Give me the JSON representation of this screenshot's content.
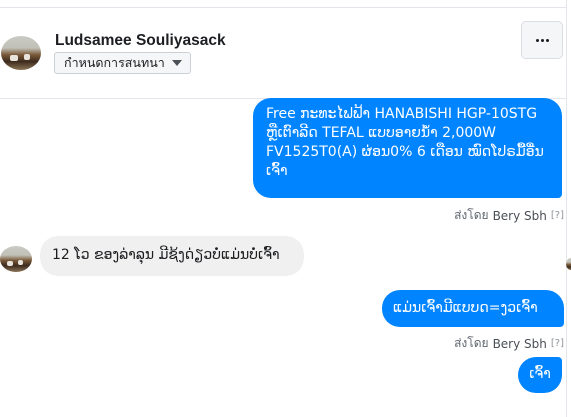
{
  "header": {
    "contact_name": "Ludsamee Souliyasack",
    "assign_label": "กำหนดการสนทนา",
    "more_label": "..."
  },
  "messages": [
    {
      "direction": "outgoing",
      "text": "Free ກະທະໄຟຟ້າ HANABISHI HGP-10STG ຫຼືເຕົາລີດ TEFAL ແບບອາຍນ້ຳ 2,000W FV1525T0(A) ຜ່ອນ0% 6 ເດືອນ ໝົດໂປຣມື້ອື່ນເຈົ້າ",
      "sent_by_prefix": "ส่งโดย",
      "sent_by_name": "Bery Sbh",
      "help_marker": "[?]"
    },
    {
      "direction": "incoming",
      "text": "12 ໂວ ຂອງລ່າລຸນ ມີຊ້ງດ່ຽວບໍ່ແມ່ນບໍ່ເຈົ້າ"
    },
    {
      "direction": "outgoing",
      "text": "ແມ່ນເຈົ້າມີແບບດ=ງວເຈົ້າ",
      "sent_by_prefix": "ส่งโดย",
      "sent_by_name": "Bery Sbh",
      "help_marker": "[?]"
    },
    {
      "direction": "outgoing",
      "text": "ເຈົ້າ"
    }
  ],
  "colors": {
    "outgoing_bubble": "#0084ff",
    "incoming_bubble": "#f1f0f0",
    "meta_text": "#606770"
  },
  "icons": {
    "more": "horizontal-ellipsis",
    "assign_dropdown": "caret-down"
  }
}
